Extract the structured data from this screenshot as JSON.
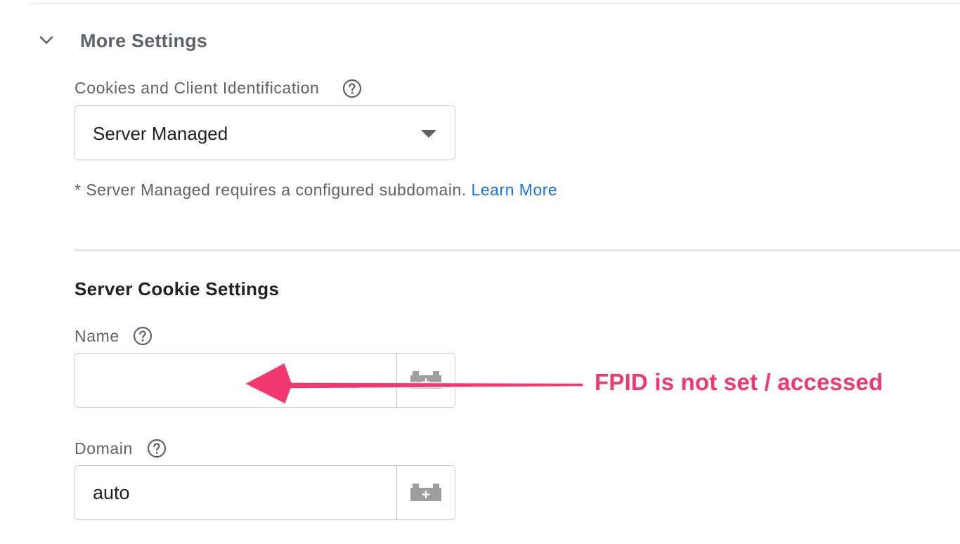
{
  "more_settings": {
    "title": "More Settings",
    "toggle_icon": "chevron-down-icon"
  },
  "cookies": {
    "label": "Cookies and Client Identification",
    "help_icon": "help-circle-icon",
    "selected_value": "Server Managed",
    "note": "* Server Managed requires a configured subdomain.",
    "learn_more": "Learn More"
  },
  "server_cookie_settings": {
    "title": "Server Cookie Settings",
    "name": {
      "label": "Name",
      "help_icon": "help-circle-icon",
      "value": "",
      "variable_icon": "add-variable-icon"
    },
    "domain": {
      "label": "Domain",
      "help_icon": "help-circle-icon",
      "value": "auto",
      "variable_icon": "add-variable-icon"
    }
  },
  "annotation": {
    "text": "FPID is not set / accessed",
    "color": "#f2396f"
  },
  "colors": {
    "link": "#1a73e8",
    "label": "#5f6368",
    "border": "#c8c8c8"
  }
}
